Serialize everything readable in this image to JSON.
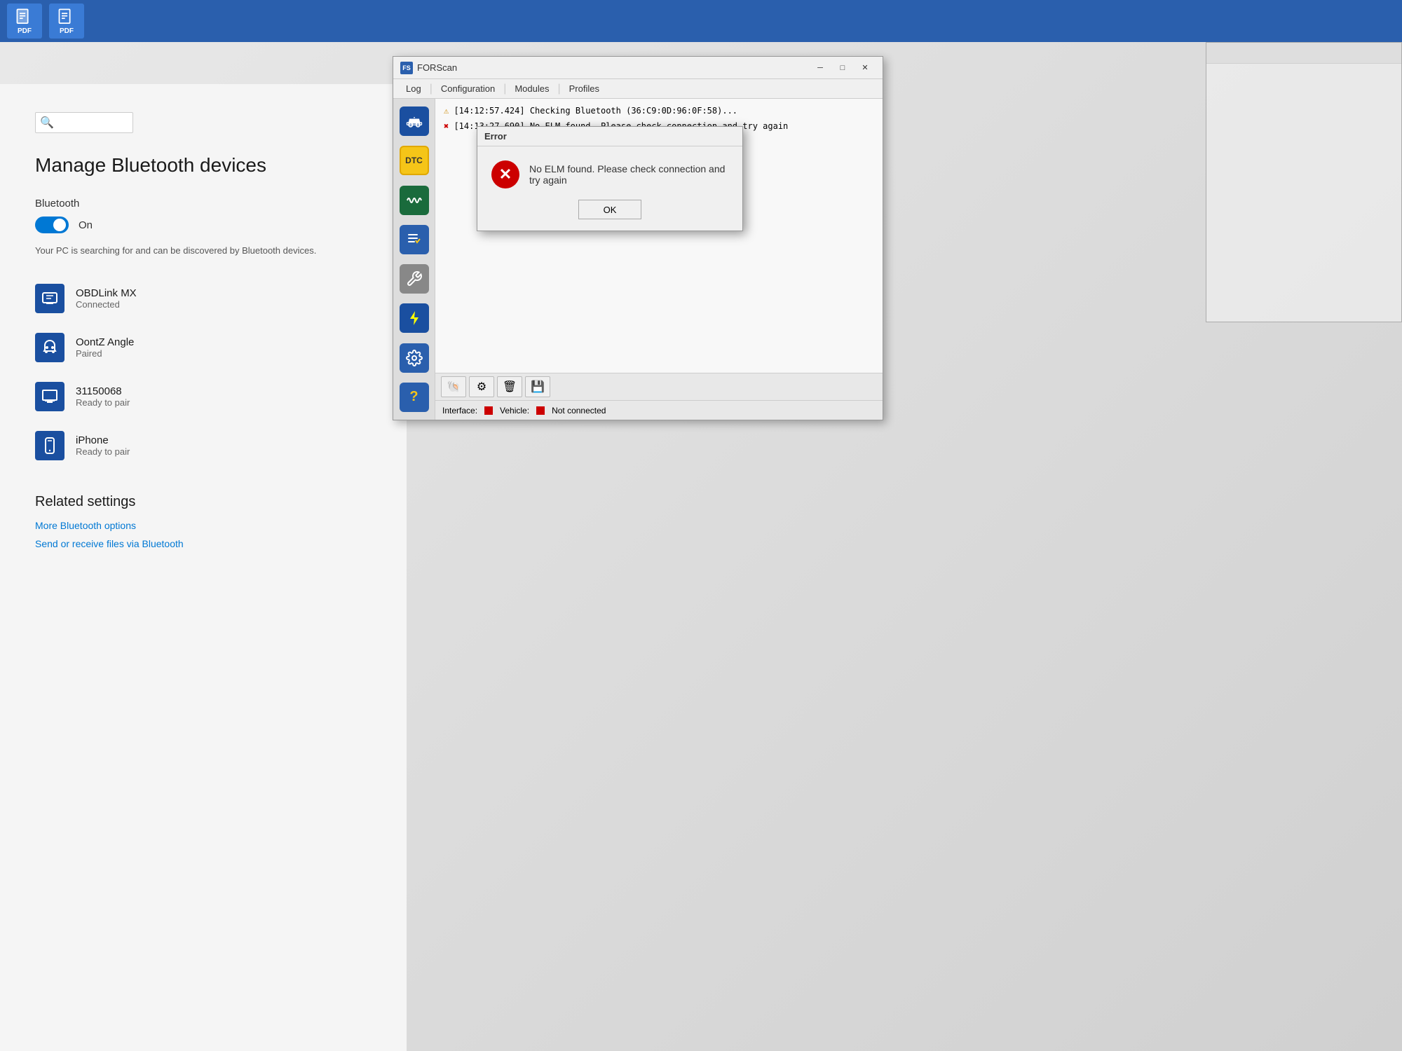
{
  "taskbar": {
    "icons": [
      {
        "name": "pdf-icon-1",
        "label": "PDF"
      },
      {
        "name": "pdf-icon-2",
        "label": "PDF"
      }
    ]
  },
  "bluetooth": {
    "title": "Manage Bluetooth devices",
    "toggle_label": "Bluetooth",
    "toggle_state": "On",
    "description": "Your PC is searching for and can be discovered by Bluetooth devices.",
    "devices": [
      {
        "name": "OBDLink MX",
        "status": "Connected",
        "icon": "💻"
      },
      {
        "name": "OontZ Angle",
        "status": "Paired",
        "icon": "🎧"
      },
      {
        "name": "31150068",
        "status": "Ready to pair",
        "icon": "🖥"
      },
      {
        "name": "iPhone",
        "status": "Ready to pair",
        "icon": "📱"
      }
    ],
    "related_settings_title": "Related settings",
    "related_links": [
      "More Bluetooth options",
      "Send or receive files via Bluetooth"
    ]
  },
  "forscan": {
    "title": "FORScan",
    "menu_items": [
      "Log",
      "Configuration",
      "Modules",
      "Profiles"
    ],
    "log_entries": [
      {
        "type": "warn",
        "text": "[14:12:57.424] Checking Bluetooth (36:C9:0D:96:0F:58)..."
      },
      {
        "type": "error",
        "text": "[14:13:27.690] No ELM found. Please check connection and try again"
      }
    ],
    "status": {
      "interface_label": "Interface:",
      "vehicle_label": "Vehicle:",
      "not_connected": "Not connected"
    },
    "toolbar_icons": [
      "🐚",
      "⚙",
      "🗑",
      "💾"
    ]
  },
  "error_dialog": {
    "title": "Error",
    "message": "No ELM found. Please check connection and try again",
    "ok_label": "OK"
  },
  "search": {
    "placeholder": ""
  }
}
